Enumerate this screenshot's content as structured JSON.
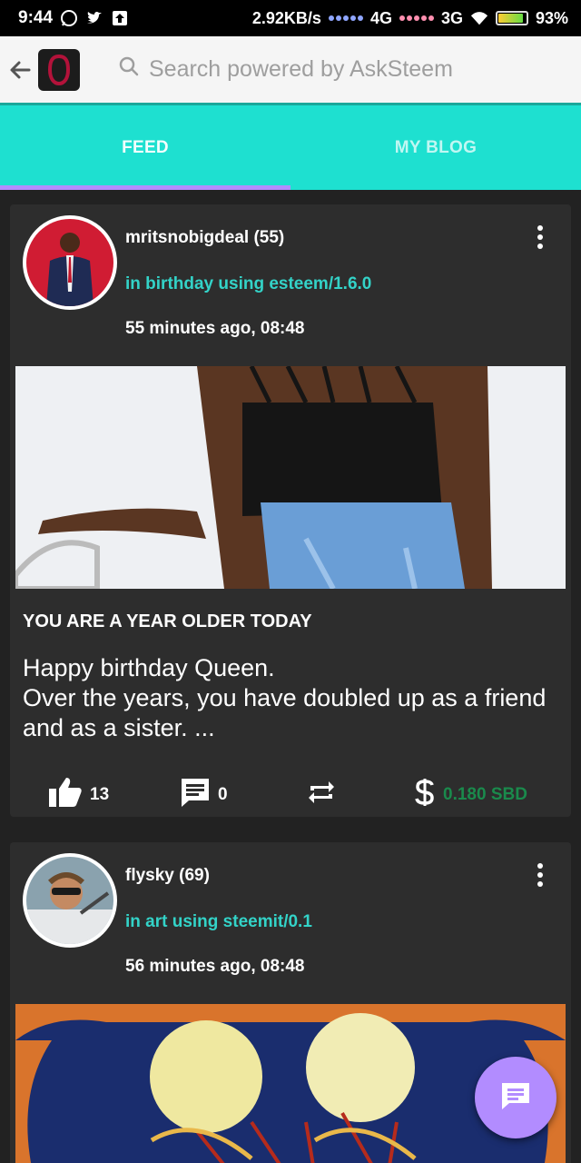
{
  "status_bar": {
    "time": "9:44",
    "network_speed": "2.92KB/s",
    "signal1": "4G",
    "signal2": "3G",
    "battery": "93%"
  },
  "app_bar": {
    "search_placeholder": "Search powered by AskSteem"
  },
  "tabs": [
    {
      "label": "FEED",
      "active": true
    },
    {
      "label": "MY BLOG",
      "active": false
    }
  ],
  "posts": [
    {
      "author": "mritsnobigdeal (55)",
      "category": "in birthday using esteem/1.6.0",
      "time": "55 minutes ago, 08:48",
      "title": "YOU ARE A YEAR OLDER TODAY",
      "body_line1": "Happy birthday Queen.",
      "body_line2": "Over the years, you have doubled up as a friend and as a sister. ...",
      "votes": "13",
      "comments": "0",
      "payout": "0.180 SBD"
    },
    {
      "author": "flysky (69)",
      "category": "in art using steemit/0.1",
      "time": "56 minutes ago, 08:48"
    }
  ],
  "colors": {
    "accent": "#1ee0d0",
    "tab_indicator": "#b28cff",
    "category_text": "#33d3c8",
    "payout": "#1a8a4c",
    "card_bg": "#2d2d2d",
    "fab": "#b28cff"
  },
  "icons": {
    "back": "arrow-left-icon",
    "search": "search-icon",
    "more": "more-vertical-icon",
    "vote": "thumb-up-icon",
    "comment": "comment-icon",
    "reblog": "repeat-icon",
    "payout": "dollar-icon",
    "fab": "chat-icon"
  }
}
